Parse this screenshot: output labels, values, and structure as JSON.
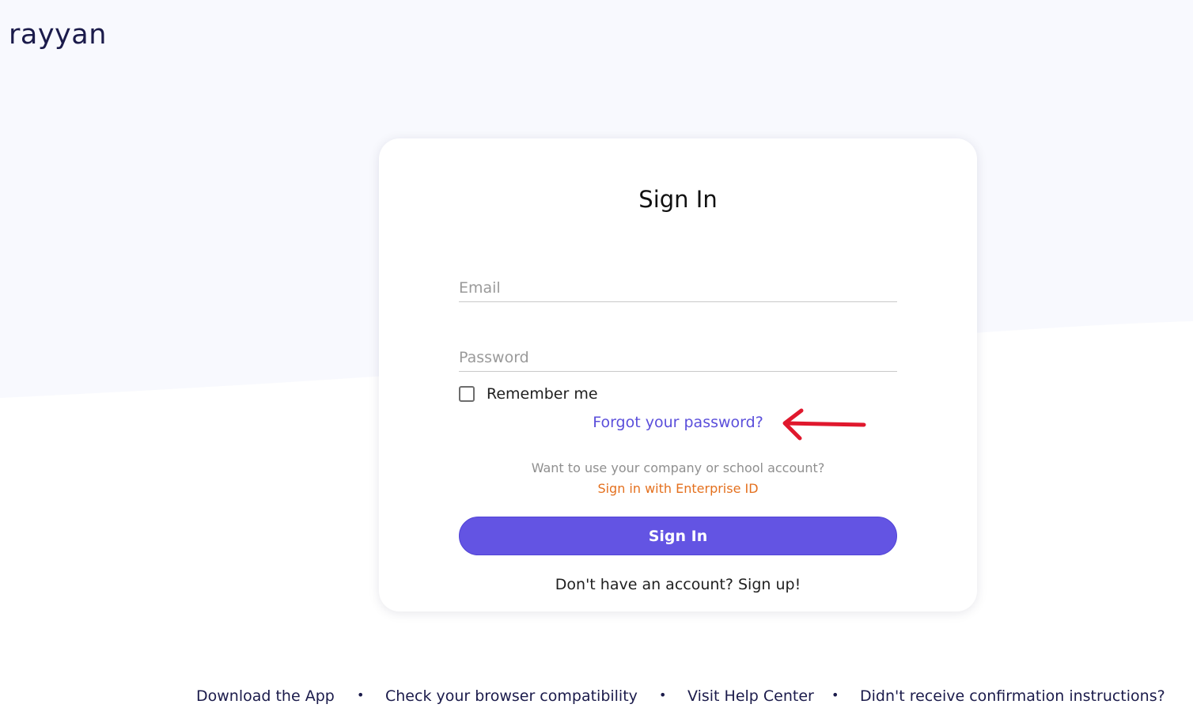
{
  "brand": {
    "logo_text": "rayyan"
  },
  "signin": {
    "title": "Sign In",
    "email_placeholder": "Email",
    "password_placeholder": "Password",
    "remember_label": "Remember me",
    "forgot_link": "Forgot your password?",
    "enterprise_prompt": "Want to use your company or school account?",
    "enterprise_link": "Sign in with Enterprise ID",
    "submit_label": "Sign In",
    "signup_link": "Don't have an account? Sign up!"
  },
  "footer": {
    "links": [
      "Download the App",
      "Check your browser compatibility",
      "Visit Help Center",
      "Didn't receive confirmation instructions?"
    ],
    "separator": "•"
  },
  "colors": {
    "primary": "#6354e3",
    "link_purple": "#5b4fdb",
    "enterprise_orange": "#e4701e",
    "annotation_arrow": "#e0182d",
    "background_tint": "#f8f9fe",
    "brand_navy": "#1b1b4b"
  },
  "icons": {
    "annotation": "red-arrow-icon",
    "checkbox": "checkbox-unchecked-icon"
  }
}
